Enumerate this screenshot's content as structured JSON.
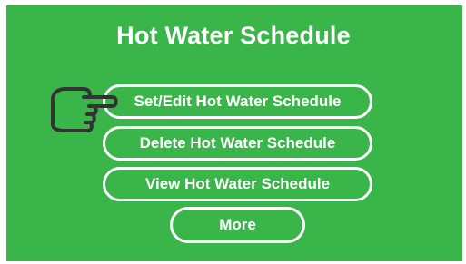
{
  "screen": {
    "title": "Hot Water Schedule",
    "background_color": "#3ab54a",
    "foreground_color": "#ffffff"
  },
  "menu": {
    "items": [
      {
        "label": "Set/Edit Hot Water Schedule"
      },
      {
        "label": "Delete Hot Water Schedule"
      },
      {
        "label": "View Hot Water Schedule"
      },
      {
        "label": "More"
      }
    ]
  },
  "cursor": {
    "icon": "pointing-hand-icon",
    "selected_item": "Set/Edit Hot Water Schedule"
  }
}
